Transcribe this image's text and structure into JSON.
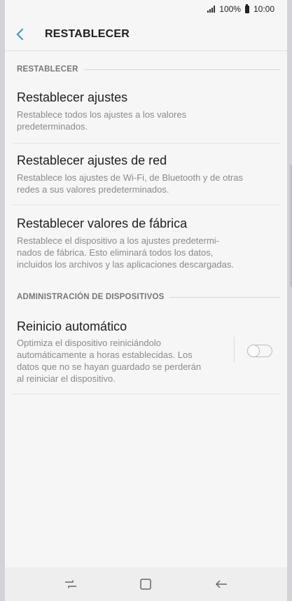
{
  "status_bar": {
    "battery": "100%",
    "time": "10:00"
  },
  "app_bar": {
    "title": "RESTABLECER"
  },
  "sections": {
    "reset_header": "RESTABLECER",
    "device_admin_header": "ADMINISTRACIÓN DE DISPOSITIVOS"
  },
  "items": [
    {
      "title": "Restablecer ajustes",
      "desc_lines": [
        "Restablece todos los ajustes a los valores",
        "predeterminados."
      ]
    },
    {
      "title": "Restablecer ajustes de red",
      "desc_lines": [
        "Restablece los ajustes de Wi-Fi, de Bluetooth y de otras",
        "redes a sus valores predeterminados."
      ]
    },
    {
      "title": "Restablecer valores de fábrica",
      "desc_lines": [
        "Restablece el dispositivo a los ajustes predetermi-",
        "nados de fábrica. Esto eliminará todos los datos,",
        "incluidos los archivos y las aplicaciones descargadas."
      ]
    }
  ],
  "auto_restart": {
    "title": "Reinicio automático",
    "desc_lines": [
      "Optimiza el dispositivo reiniciándolo",
      "automáticamente a horas establecidas. Los",
      "datos que no se hayan guardado se perderán",
      "al reiniciar el dispositivo."
    ],
    "enabled": false
  },
  "icons": {
    "back": "chevron-left-icon",
    "nav_recent": "recent-apps-icon",
    "nav_home": "home-icon",
    "nav_back": "back-arrow-icon"
  },
  "colors": {
    "accent": "#3a94b4",
    "background": "#f6f6f6"
  }
}
